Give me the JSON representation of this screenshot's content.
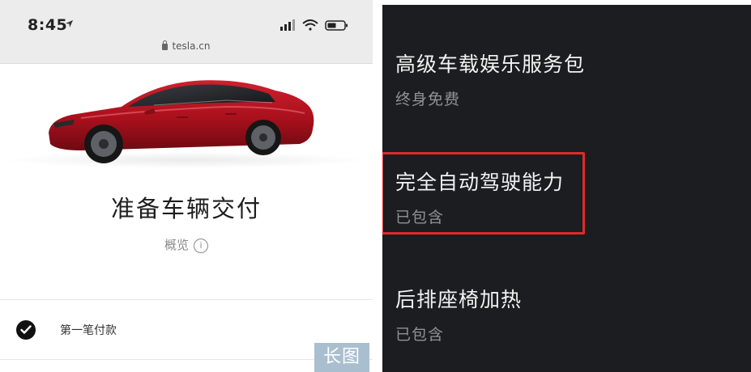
{
  "status_bar": {
    "time": "8:45",
    "url": "tesla.cn",
    "icons": [
      "location-arrow-icon",
      "cellular-signal-icon",
      "wifi-icon",
      "battery-icon"
    ]
  },
  "delivery": {
    "title": "准备车辆交付",
    "overview_label": "概览",
    "info_symbol": "i",
    "steps": [
      {
        "label": "第一笔付款",
        "status": "completed"
      }
    ]
  },
  "badge": {
    "label": "长图",
    "color": "#a9bfd0"
  },
  "features": [
    {
      "title": "高级车载娱乐服务包",
      "status": "终身免费",
      "highlighted": false
    },
    {
      "title": "完全自动驾驶能力",
      "status": "已包含",
      "highlighted": true
    },
    {
      "title": "后排座椅加热",
      "status": "已包含",
      "highlighted": false
    }
  ],
  "colors": {
    "car_body": "#b3121f",
    "highlight": "#e02a2a",
    "dark_panel": "#1b1d20"
  }
}
